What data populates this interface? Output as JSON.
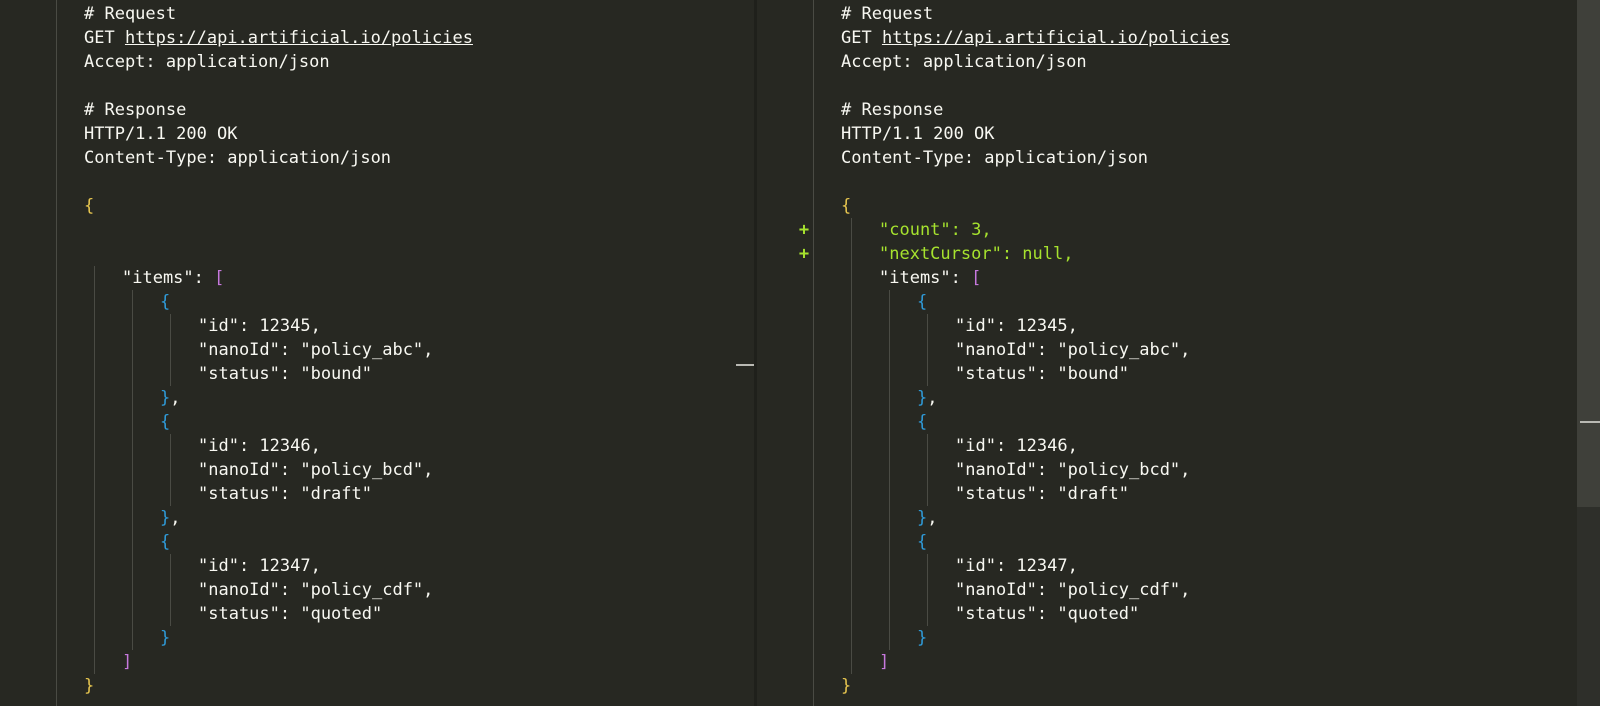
{
  "colors": {
    "background": "#272822",
    "text": "#f8f8f2",
    "brace": "#e6c54f",
    "bracket": "#c678dd",
    "inner_brace": "#2f9bd9",
    "added": "#a6e22e",
    "guide": "#4a4b44"
  },
  "left_pane": {
    "lines": [
      {
        "row": 0,
        "indent": 0,
        "tokens": [
          {
            "t": "# Request"
          }
        ]
      },
      {
        "row": 1,
        "indent": 0,
        "tokens": [
          {
            "t": "GET "
          },
          {
            "t": "https://api.artificial.io/policies",
            "c": "url"
          }
        ]
      },
      {
        "row": 2,
        "indent": 0,
        "tokens": [
          {
            "t": "Accept: application/json"
          }
        ]
      },
      {
        "row": 4,
        "indent": 0,
        "tokens": [
          {
            "t": "# Response"
          }
        ]
      },
      {
        "row": 5,
        "indent": 0,
        "tokens": [
          {
            "t": "HTTP/1.1 200 OK"
          }
        ]
      },
      {
        "row": 6,
        "indent": 0,
        "tokens": [
          {
            "t": "Content-Type: application/json"
          }
        ]
      },
      {
        "row": 8,
        "indent": 0,
        "tokens": [
          {
            "t": "{",
            "c": "brace"
          }
        ]
      },
      {
        "row": 11,
        "indent": 1,
        "tokens": [
          {
            "t": "\"items\": "
          },
          {
            "t": "[",
            "c": "bracket"
          }
        ]
      },
      {
        "row": 12,
        "indent": 2,
        "tokens": [
          {
            "t": "{",
            "c": "inner_brace"
          }
        ]
      },
      {
        "row": 13,
        "indent": 3,
        "tokens": [
          {
            "t": "\"id\": 12345,"
          }
        ]
      },
      {
        "row": 14,
        "indent": 3,
        "tokens": [
          {
            "t": "\"nanoId\": \"policy_abc\","
          }
        ]
      },
      {
        "row": 15,
        "indent": 3,
        "tokens": [
          {
            "t": "\"status\": \"bound\""
          }
        ]
      },
      {
        "row": 16,
        "indent": 2,
        "tokens": [
          {
            "t": "}",
            "c": "inner_brace"
          },
          {
            "t": ","
          }
        ]
      },
      {
        "row": 17,
        "indent": 2,
        "tokens": [
          {
            "t": "{",
            "c": "inner_brace"
          }
        ]
      },
      {
        "row": 18,
        "indent": 3,
        "tokens": [
          {
            "t": "\"id\": 12346,"
          }
        ]
      },
      {
        "row": 19,
        "indent": 3,
        "tokens": [
          {
            "t": "\"nanoId\": \"policy_bcd\","
          }
        ]
      },
      {
        "row": 20,
        "indent": 3,
        "tokens": [
          {
            "t": "\"status\": \"draft\""
          }
        ]
      },
      {
        "row": 21,
        "indent": 2,
        "tokens": [
          {
            "t": "}",
            "c": "inner_brace"
          },
          {
            "t": ","
          }
        ]
      },
      {
        "row": 22,
        "indent": 2,
        "tokens": [
          {
            "t": "{",
            "c": "inner_brace"
          }
        ]
      },
      {
        "row": 23,
        "indent": 3,
        "tokens": [
          {
            "t": "\"id\": 12347,"
          }
        ]
      },
      {
        "row": 24,
        "indent": 3,
        "tokens": [
          {
            "t": "\"nanoId\": \"policy_cdf\","
          }
        ]
      },
      {
        "row": 25,
        "indent": 3,
        "tokens": [
          {
            "t": "\"status\": \"quoted\""
          }
        ]
      },
      {
        "row": 26,
        "indent": 2,
        "tokens": [
          {
            "t": "}",
            "c": "inner_brace"
          }
        ]
      },
      {
        "row": 27,
        "indent": 1,
        "tokens": [
          {
            "t": "]",
            "c": "bracket"
          }
        ]
      },
      {
        "row": 28,
        "indent": 0,
        "tokens": [
          {
            "t": "}",
            "c": "brace"
          }
        ]
      }
    ]
  },
  "right_pane": {
    "lines": [
      {
        "row": 0,
        "indent": 0,
        "tokens": [
          {
            "t": "# Request"
          }
        ]
      },
      {
        "row": 1,
        "indent": 0,
        "tokens": [
          {
            "t": "GET "
          },
          {
            "t": "https://api.artificial.io/policies",
            "c": "url"
          }
        ]
      },
      {
        "row": 2,
        "indent": 0,
        "tokens": [
          {
            "t": "Accept: application/json"
          }
        ]
      },
      {
        "row": 4,
        "indent": 0,
        "tokens": [
          {
            "t": "# Response"
          }
        ]
      },
      {
        "row": 5,
        "indent": 0,
        "tokens": [
          {
            "t": "HTTP/1.1 200 OK"
          }
        ]
      },
      {
        "row": 6,
        "indent": 0,
        "tokens": [
          {
            "t": "Content-Type: application/json"
          }
        ]
      },
      {
        "row": 8,
        "indent": 0,
        "tokens": [
          {
            "t": "{",
            "c": "brace"
          }
        ]
      },
      {
        "row": 9,
        "indent": 1,
        "marker": "+",
        "tokens": [
          {
            "t": "\"count\": 3,",
            "c": "added"
          }
        ]
      },
      {
        "row": 10,
        "indent": 1,
        "marker": "+",
        "tokens": [
          {
            "t": "\"nextCursor\": null,",
            "c": "added"
          }
        ]
      },
      {
        "row": 11,
        "indent": 1,
        "tokens": [
          {
            "t": "\"items\": "
          },
          {
            "t": "[",
            "c": "bracket"
          }
        ]
      },
      {
        "row": 12,
        "indent": 2,
        "tokens": [
          {
            "t": "{",
            "c": "inner_brace"
          }
        ]
      },
      {
        "row": 13,
        "indent": 3,
        "tokens": [
          {
            "t": "\"id\": 12345,"
          }
        ]
      },
      {
        "row": 14,
        "indent": 3,
        "tokens": [
          {
            "t": "\"nanoId\": \"policy_abc\","
          }
        ]
      },
      {
        "row": 15,
        "indent": 3,
        "tokens": [
          {
            "t": "\"status\": \"bound\""
          }
        ]
      },
      {
        "row": 16,
        "indent": 2,
        "tokens": [
          {
            "t": "}",
            "c": "inner_brace"
          },
          {
            "t": ","
          }
        ]
      },
      {
        "row": 17,
        "indent": 2,
        "tokens": [
          {
            "t": "{",
            "c": "inner_brace"
          }
        ]
      },
      {
        "row": 18,
        "indent": 3,
        "tokens": [
          {
            "t": "\"id\": 12346,"
          }
        ]
      },
      {
        "row": 19,
        "indent": 3,
        "tokens": [
          {
            "t": "\"nanoId\": \"policy_bcd\","
          }
        ]
      },
      {
        "row": 20,
        "indent": 3,
        "tokens": [
          {
            "t": "\"status\": \"draft\""
          }
        ]
      },
      {
        "row": 21,
        "indent": 2,
        "tokens": [
          {
            "t": "}",
            "c": "inner_brace"
          },
          {
            "t": ","
          }
        ]
      },
      {
        "row": 22,
        "indent": 2,
        "tokens": [
          {
            "t": "{",
            "c": "inner_brace"
          }
        ]
      },
      {
        "row": 23,
        "indent": 3,
        "tokens": [
          {
            "t": "\"id\": 12347,"
          }
        ]
      },
      {
        "row": 24,
        "indent": 3,
        "tokens": [
          {
            "t": "\"nanoId\": \"policy_cdf\","
          }
        ]
      },
      {
        "row": 25,
        "indent": 3,
        "tokens": [
          {
            "t": "\"status\": \"quoted\""
          }
        ]
      },
      {
        "row": 26,
        "indent": 2,
        "tokens": [
          {
            "t": "}",
            "c": "inner_brace"
          }
        ]
      },
      {
        "row": 27,
        "indent": 1,
        "tokens": [
          {
            "t": "]",
            "c": "bracket"
          }
        ]
      },
      {
        "row": 28,
        "indent": 0,
        "tokens": [
          {
            "t": "}",
            "c": "brace"
          }
        ]
      }
    ]
  }
}
